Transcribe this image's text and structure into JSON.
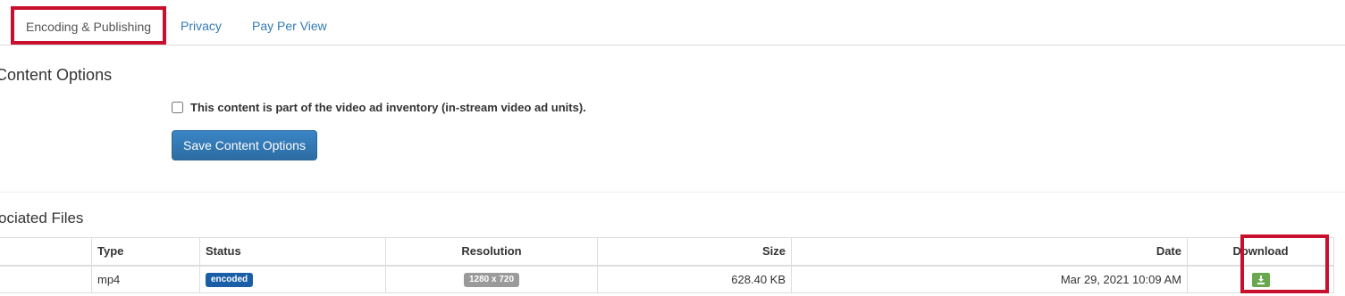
{
  "tabs": [
    {
      "label": "Encoding & Publishing",
      "active": true
    },
    {
      "label": "Privacy",
      "active": false
    },
    {
      "label": "Pay Per View",
      "active": false
    }
  ],
  "content_options": {
    "title": "Content Options",
    "checkbox_label": "This content is part of the video ad inventory (in-stream video ad units).",
    "checkbox_checked": false,
    "save_button": "Save Content Options"
  },
  "associated_files": {
    "title": "ociated Files",
    "columns": [
      "Type",
      "Status",
      "Resolution",
      "Size",
      "Date",
      "Download"
    ],
    "rows": [
      {
        "type": "mp4",
        "status": "encoded",
        "resolution": "1280 x 720",
        "size": "628.40 KB",
        "date": "Mar 29, 2021 10:09 AM",
        "download_icon": "download-icon"
      }
    ]
  },
  "colors": {
    "highlight_box": "#c8102e",
    "link": "#337ab7",
    "primary_button": "#337ab7",
    "status_label": "#1a5ea8",
    "resolution_label": "#9a9a9a",
    "download_button": "#6aa84f"
  }
}
